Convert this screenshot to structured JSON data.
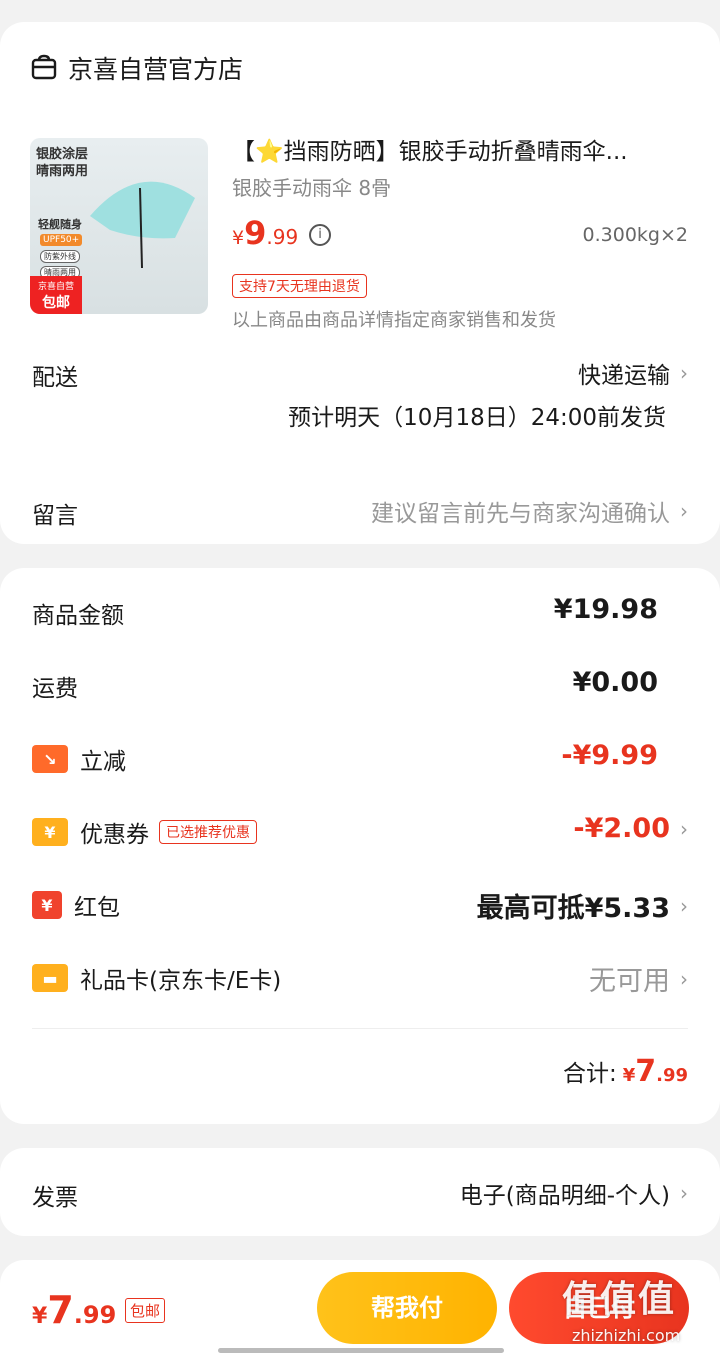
{
  "store": {
    "name": "京喜自营官方店"
  },
  "product": {
    "title": "【⭐挡雨防晒】银胶手动折叠晴雨伞...",
    "spec": "银胶手动雨伞 8骨",
    "price_symbol": "¥",
    "price_int": "9",
    "price_dec": ".99",
    "weight_qty": "0.300kg×2",
    "return_badge": "支持7天无理由退货",
    "seller_note": "以上商品由商品详情指定商家销售和发货",
    "image": {
      "text_line1": "银胶涂层",
      "text_line2": "晴雨两用",
      "text_line3": "轻舰随身",
      "upf": "UPF50+",
      "tag1": "防紫外线",
      "tag2": "晴雨两用",
      "ship_a": "京喜自营",
      "ship_b": "包邮"
    }
  },
  "delivery": {
    "label": "配送",
    "method": "快递运输",
    "eta": "预计明天（10月18日）24:00前发货"
  },
  "message": {
    "label": "留言",
    "placeholder": "建议留言前先与商家沟通确认"
  },
  "pricing": {
    "goods_label": "商品金额",
    "goods_value": "¥19.98",
    "shipping_label": "运费",
    "shipping_value": "¥0.00",
    "discount_label": "立减",
    "discount_value": "-¥9.99",
    "coupon_label": "优惠券",
    "coupon_tag": "已选推荐优惠",
    "coupon_value": "-¥2.00",
    "redpacket_label": "红包",
    "redpacket_value": "最高可抵¥5.33",
    "giftcard_label": "礼品卡(京东卡/E卡)",
    "giftcard_value": "无可用",
    "total_label": "合计:",
    "total_symbol": "¥",
    "total_int": "7",
    "total_dec": ".99"
  },
  "invoice": {
    "label": "发票",
    "value": "电子(商品明细-个人)"
  },
  "bottom": {
    "price_symbol": "¥",
    "price_int": "7",
    "price_dec": ".99",
    "free_shipping": "包邮",
    "help_pay": "帮我付",
    "self_pay": "自己付"
  },
  "watermark": {
    "logo": "值值值",
    "url": "zhizhizhi.com"
  },
  "colors": {
    "accent_red": "#e8341f",
    "accent_yellow": "#ffb300",
    "icon_orange": "#ff8a1e"
  },
  "icons": {
    "store": "store-icon",
    "info": "info-icon",
    "chevron": "chevron-right-icon",
    "discount": "price-drop-icon",
    "coupon": "coupon-icon",
    "redpacket": "red-packet-icon",
    "giftcard": "gift-card-icon"
  }
}
